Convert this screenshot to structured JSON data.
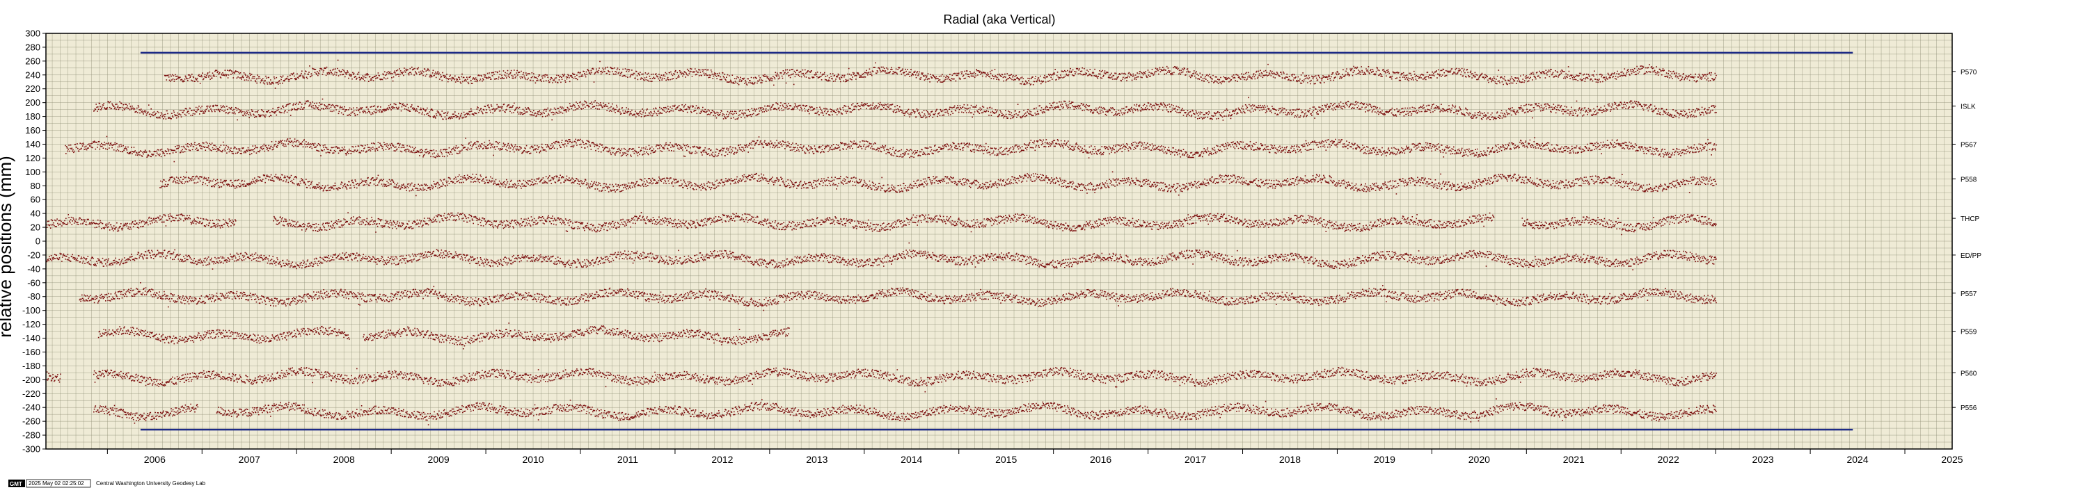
{
  "chart_data": {
    "type": "scatter",
    "title": "Radial (aka Vertical)",
    "ylabel": "relative positions (mm)",
    "xlabel": "",
    "xlim": [
      2005.35,
      2025.5
    ],
    "ylim": [
      -300,
      300
    ],
    "y_ticks": [
      300,
      280,
      260,
      240,
      220,
      200,
      180,
      160,
      140,
      120,
      100,
      80,
      60,
      40,
      20,
      0,
      -20,
      -40,
      -60,
      -80,
      -100,
      -120,
      -140,
      -160,
      -180,
      -200,
      -220,
      -240,
      -260,
      -280,
      -300
    ],
    "x_ticks": [
      "2006",
      "2007",
      "2008",
      "2009",
      "2010",
      "2011",
      "2012",
      "2013",
      "2014",
      "2015",
      "2016",
      "2017",
      "2018",
      "2019",
      "2020",
      "2021",
      "2022",
      "2023",
      "2024",
      "2025"
    ],
    "grid": true,
    "background_color": "#efebd6",
    "point_color": "#7a0c0c",
    "reference_line_color": "#1c2a86",
    "reference_lines": [
      {
        "y": 272,
        "x_start": 2006.35,
        "x_end": 2024.45
      },
      {
        "y": -272,
        "x_start": 2006.35,
        "x_end": 2024.45
      }
    ],
    "series": [
      {
        "name": "P570",
        "offset": 240,
        "segments": [
          [
            2006.6,
            2023.0
          ]
        ]
      },
      {
        "name": "ISLK",
        "offset": 190,
        "segments": [
          [
            2005.85,
            2023.0
          ]
        ]
      },
      {
        "name": "P567",
        "offset": 135,
        "segments": [
          [
            2005.55,
            2023.0
          ]
        ]
      },
      {
        "name": "P558",
        "offset": 85,
        "segments": [
          [
            2006.55,
            2023.0
          ]
        ]
      },
      {
        "name": "THCP",
        "offset": 28,
        "segments": [
          [
            2005.35,
            2007.35
          ],
          [
            2007.75,
            2020.65
          ],
          [
            2020.95,
            2023.0
          ]
        ]
      },
      {
        "name": "ED/PP",
        "offset": -25,
        "segments": [
          [
            2005.35,
            2023.0
          ]
        ]
      },
      {
        "name": "P557",
        "offset": -80,
        "segments": [
          [
            2005.7,
            2023.0
          ]
        ]
      },
      {
        "name": "P559",
        "offset": -135,
        "segments": [
          [
            2005.9,
            2008.55
          ],
          [
            2008.7,
            2013.2
          ]
        ]
      },
      {
        "name": "P560",
        "offset": -195,
        "segments": [
          [
            2005.35,
            2005.5
          ],
          [
            2005.85,
            2023.0
          ]
        ]
      },
      {
        "name": "P556",
        "offset": -245,
        "segments": [
          [
            2005.85,
            2006.95
          ],
          [
            2007.15,
            2023.0
          ]
        ]
      }
    ]
  },
  "footer": {
    "logo_text": "GMT",
    "timestamp": "2025 May 02 02:25:02",
    "lab": "Central Washington University Geodesy Lab"
  }
}
